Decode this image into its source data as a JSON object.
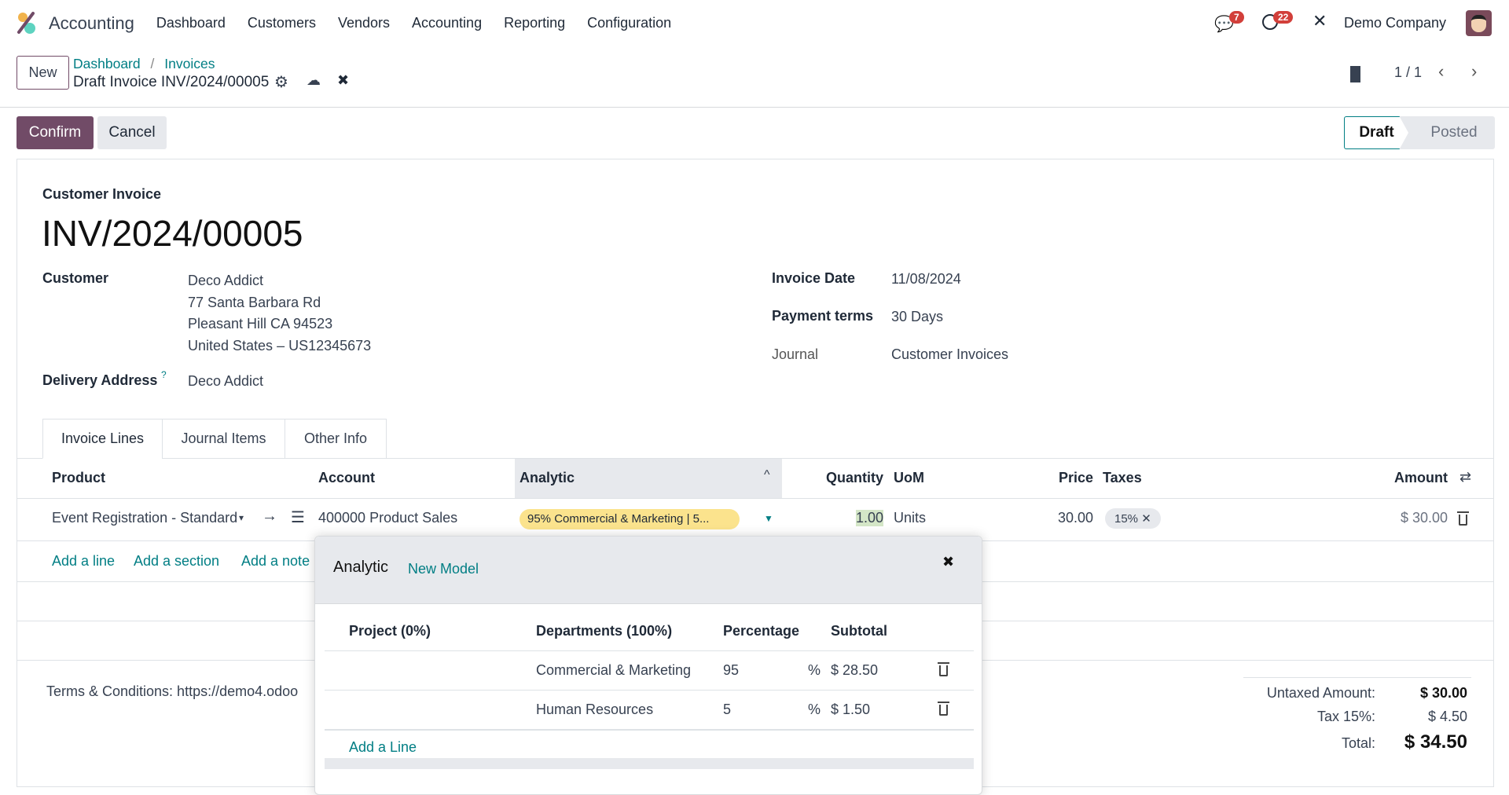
{
  "nav": {
    "app": "Accounting",
    "menu": [
      "Dashboard",
      "Customers",
      "Vendors",
      "Accounting",
      "Reporting",
      "Configuration"
    ],
    "messages_count": "7",
    "activities_count": "22",
    "company": "Demo Company"
  },
  "control": {
    "new_label": "New",
    "breadcrumb": [
      "Dashboard",
      "Invoices"
    ],
    "record": "Draft Invoice INV/2024/00005",
    "pager": "1 / 1",
    "confirm": "Confirm",
    "cancel": "Cancel",
    "states": [
      "Draft",
      "Posted"
    ],
    "active_state": "Draft"
  },
  "form": {
    "type": "Customer Invoice",
    "number": "INV/2024/00005",
    "customer_label": "Customer",
    "customer": [
      "Deco Addict",
      "77 Santa Barbara Rd",
      "Pleasant Hill CA 94523",
      "United States – US12345673"
    ],
    "delivery_label": "Delivery Address",
    "delivery_help": "?",
    "delivery": "Deco Addict",
    "invoice_date_label": "Invoice Date",
    "invoice_date": "11/08/2024",
    "payment_terms_label": "Payment terms",
    "payment_terms": "30 Days",
    "journal_label": "Journal",
    "journal": "Customer Invoices"
  },
  "tabs": [
    "Invoice Lines",
    "Journal Items",
    "Other Info"
  ],
  "lines": {
    "headers": {
      "product": "Product",
      "account": "Account",
      "analytic": "Analytic",
      "quantity": "Quantity",
      "uom": "UoM",
      "price": "Price",
      "taxes": "Taxes",
      "amount": "Amount"
    },
    "row": {
      "product": "Event Registration - Standard",
      "account": "400000 Product Sales",
      "analytic": "95% Commercial & Marketing | 5...",
      "quantity": "1.00",
      "uom": "Units",
      "price": "30.00",
      "tax": "15%",
      "amount": "$ 30.00"
    },
    "add": [
      "Add a line",
      "Add a section",
      "Add a note"
    ]
  },
  "terms": "Terms & Conditions: https://demo4.odoo",
  "totals": {
    "untaxed_label": "Untaxed Amount:",
    "untaxed": "$ 30.00",
    "tax_label": "Tax 15%:",
    "tax": "$ 4.50",
    "total_label": "Total:",
    "total": "$ 34.50"
  },
  "analytic_popup": {
    "title": "Analytic",
    "new_model": "New Model",
    "headers": [
      "Project (0%)",
      "Departments (100%)",
      "Percentage",
      "Subtotal"
    ],
    "rows": [
      {
        "department": "Commercial & Marketing",
        "percentage": "95",
        "pct": "%",
        "subtotal": "$ 28.50"
      },
      {
        "department": "Human Resources",
        "percentage": "5",
        "pct": "%",
        "subtotal": "$ 1.50"
      }
    ],
    "add_line": "Add a Line"
  },
  "colors": {
    "primary": "#714b67",
    "link": "#017e84",
    "badge": "#d23f3a",
    "analytic_tag": "#fbe38d"
  }
}
